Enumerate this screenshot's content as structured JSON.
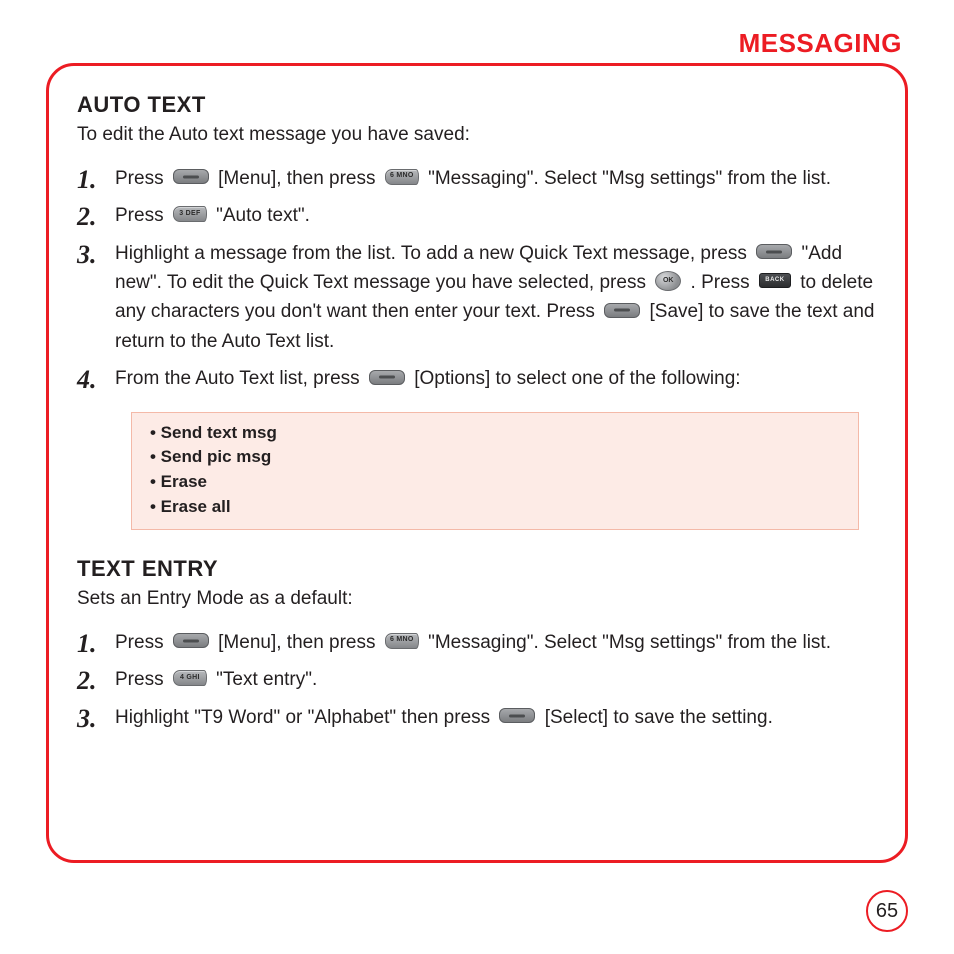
{
  "chapter": "MESSAGING",
  "page_number": "65",
  "sec1": {
    "title": "AUTO TEXT",
    "intro": "To edit the Auto text message you have saved:",
    "step1a": "Press ",
    "step1b": " [Menu], then press ",
    "step1c": " \"Messaging\".  Select \"Msg settings\" from the list.",
    "step2a": "Press ",
    "step2b": " \"Auto text\".",
    "step3a": "Highlight a message from the list.  To add a new Quick Text message, press ",
    "step3b": " \"Add new\". To edit the Quick Text message you have selected, press ",
    "step3c": " .  Press ",
    "step3d": " to delete any characters you don't want then enter your text.  Press ",
    "step3e": " [Save] to save the text and return to the Auto Text list.",
    "step4a": "From the Auto Text list, press ",
    "step4b": " [Options] to select one of the following:",
    "options": {
      "o1": "• Send text msg",
      "o2": "• Send pic msg",
      "o3": "• Erase",
      "o4": "• Erase all"
    }
  },
  "sec2": {
    "title": "TEXT ENTRY",
    "intro": "Sets an Entry Mode as a default:",
    "step1a": "Press ",
    "step1b": " [Menu], then press ",
    "step1c": " \"Messaging\".  Select \"Msg settings\" from the list.",
    "step2a": "Press ",
    "step2b": " \"Text entry\".",
    "step3a": "Highlight  \"T9 Word\" or \"Alphabet\" then press ",
    "step3b": " [Select] to save the setting."
  },
  "keys": {
    "six": "6 MNO",
    "three": "3 DEF",
    "four": "4 GHI",
    "ok": "OK",
    "back": "BACK"
  }
}
